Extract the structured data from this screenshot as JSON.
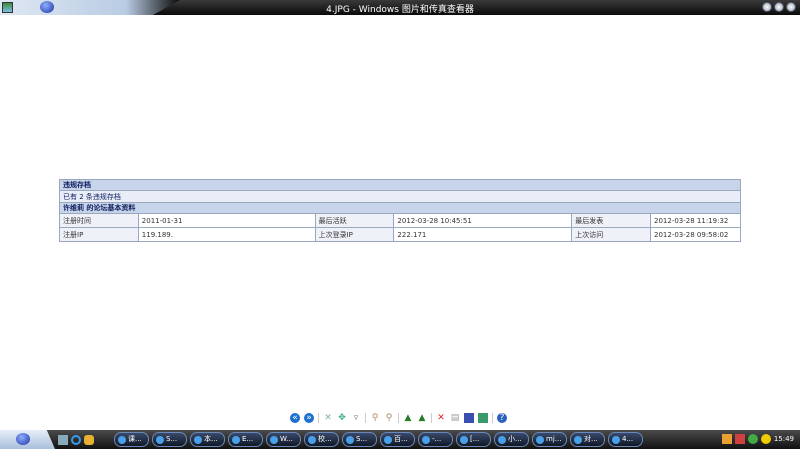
{
  "window": {
    "title": "4.JPG - Windows 图片和传真查看器"
  },
  "table": {
    "section1": "违规存档",
    "violations": "已有 2 条违规存档",
    "section2": "许维莉 的论坛基本资料",
    "rows": [
      {
        "l1": "注册时间",
        "v1": "2011-01-31",
        "l2": "最后活跃",
        "v2": "2012-03-28 10:45:51",
        "l3": "最后发表",
        "v3": "2012-03-28 11:19:32"
      },
      {
        "l1": "注册IP",
        "v1": "119.189.",
        "l2": "上次登录IP",
        "v2": "222.171",
        "l3": "上次访问",
        "v3": "2012-03-28 09:58:02"
      }
    ]
  },
  "taskbar": {
    "tasks": [
      "课...",
      "S...",
      "本...",
      "E...",
      "W...",
      "校...",
      "S...",
      "百...",
      "-...",
      "[...",
      "小...",
      "mj...",
      "对...",
      "4..."
    ],
    "clock": "15:49"
  }
}
